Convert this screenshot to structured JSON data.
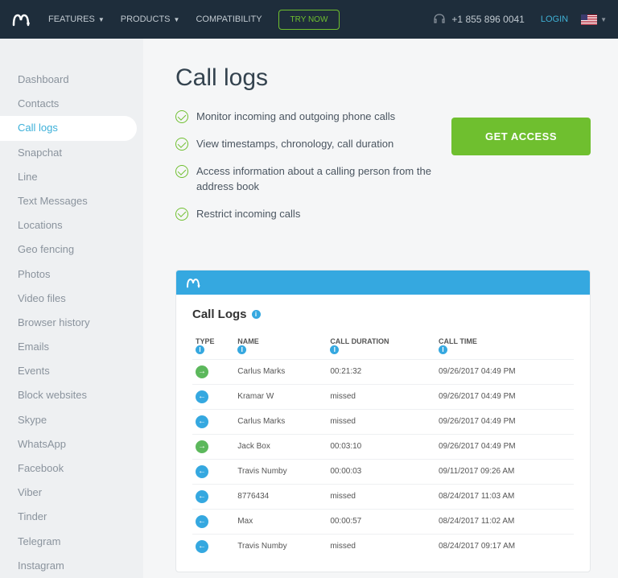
{
  "topbar": {
    "features": "FEATURES",
    "products": "PRODUCTS",
    "compat": "COMPATIBILITY",
    "try": "TRY NOW",
    "phone": "+1 855 896 0041",
    "login": "LOGIN"
  },
  "sidebar": {
    "items": [
      "Dashboard",
      "Contacts",
      "Call logs",
      "Snapchat",
      "Line",
      "Text Messages",
      "Locations",
      "Geo fencing",
      "Photos",
      "Video files",
      "Browser history",
      "Emails",
      "Events",
      "Block websites",
      "Skype",
      "WhatsApp",
      "Facebook",
      "Viber",
      "Tinder",
      "Telegram",
      "Instagram"
    ],
    "active": 2
  },
  "page": {
    "title": "Call logs",
    "features": [
      "Monitor incoming and outgoing phone calls",
      "View timestamps, chronology, call duration",
      "Access information about a calling person from the address book",
      "Restrict incoming calls"
    ],
    "cta": "GET ACCESS"
  },
  "demo": {
    "title": "Call Logs",
    "cols": {
      "type": "TYPE",
      "name": "NAME",
      "dur": "CALL DURATION",
      "time": "CALL TIME"
    },
    "rows": [
      {
        "t": "out",
        "n": "Carlus Marks",
        "d": "00:21:32",
        "tm": "09/26/2017 04:49 PM"
      },
      {
        "t": "in",
        "n": "Kramar W",
        "d": "missed",
        "tm": "09/26/2017 04:49 PM"
      },
      {
        "t": "in",
        "n": "Carlus Marks",
        "d": "missed",
        "tm": "09/26/2017 04:49 PM"
      },
      {
        "t": "out",
        "n": "Jack Box",
        "d": "00:03:10",
        "tm": "09/26/2017 04:49 PM"
      },
      {
        "t": "in",
        "n": "Travis Numby",
        "d": "00:00:03",
        "tm": "09/11/2017 09:26 AM"
      },
      {
        "t": "in",
        "n": "8776434",
        "d": "missed",
        "tm": "08/24/2017 11:03 AM"
      },
      {
        "t": "in",
        "n": "Max",
        "d": "00:00:57",
        "tm": "08/24/2017 11:02 AM"
      },
      {
        "t": "in",
        "n": "Travis Numby",
        "d": "missed",
        "tm": "08/24/2017 09:17 AM"
      }
    ]
  }
}
